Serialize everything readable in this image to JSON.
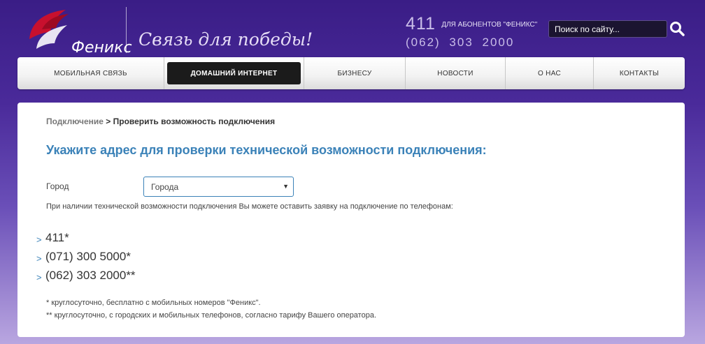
{
  "brand": {
    "logo_text": "Феникс",
    "slogan": "Связь для победы!",
    "accent_color": "#c8102e"
  },
  "header": {
    "phone_short": "411",
    "phone_note": "ДЛЯ АБОНЕНТОВ \"ФЕНИКС\"",
    "phone_long": "(062) 303 2000",
    "search_placeholder": "Поиск по сайту...",
    "search_icon": "search-icon"
  },
  "nav": {
    "items": [
      {
        "label": "МОБИЛЬНАЯ СВЯЗЬ",
        "active": false
      },
      {
        "label": "ДОМАШНИЙ ИНТЕРНЕТ",
        "active": true
      },
      {
        "label": "БИЗНЕСУ",
        "active": false
      },
      {
        "label": "НОВОСТИ",
        "active": false
      },
      {
        "label": "О НАС",
        "active": false
      },
      {
        "label": "КОНТАКТЫ",
        "active": false
      }
    ]
  },
  "breadcrumb": {
    "link": "Подключение",
    "separator": ">",
    "current": "Проверить возможность подключения"
  },
  "main": {
    "heading": "Укажите адрес для проверки технической возможности подключения:",
    "city_label": "Город",
    "city_select_value": "Города",
    "info_text": "При наличии технической возможности подключения Вы можете оставить заявку на подключение по телефонам:",
    "phones": [
      "411*",
      "(071) 300 5000*",
      "(062) 303 2000**"
    ],
    "bullet": ">",
    "footnotes": [
      "* круглосуточно, бесплатно с мобильных номеров \"Феникс\".",
      "** круглосуточно, с городских и мобильных телефонов, согласно тарифу Вашего оператора."
    ],
    "heading_color": "#3b82b8"
  }
}
